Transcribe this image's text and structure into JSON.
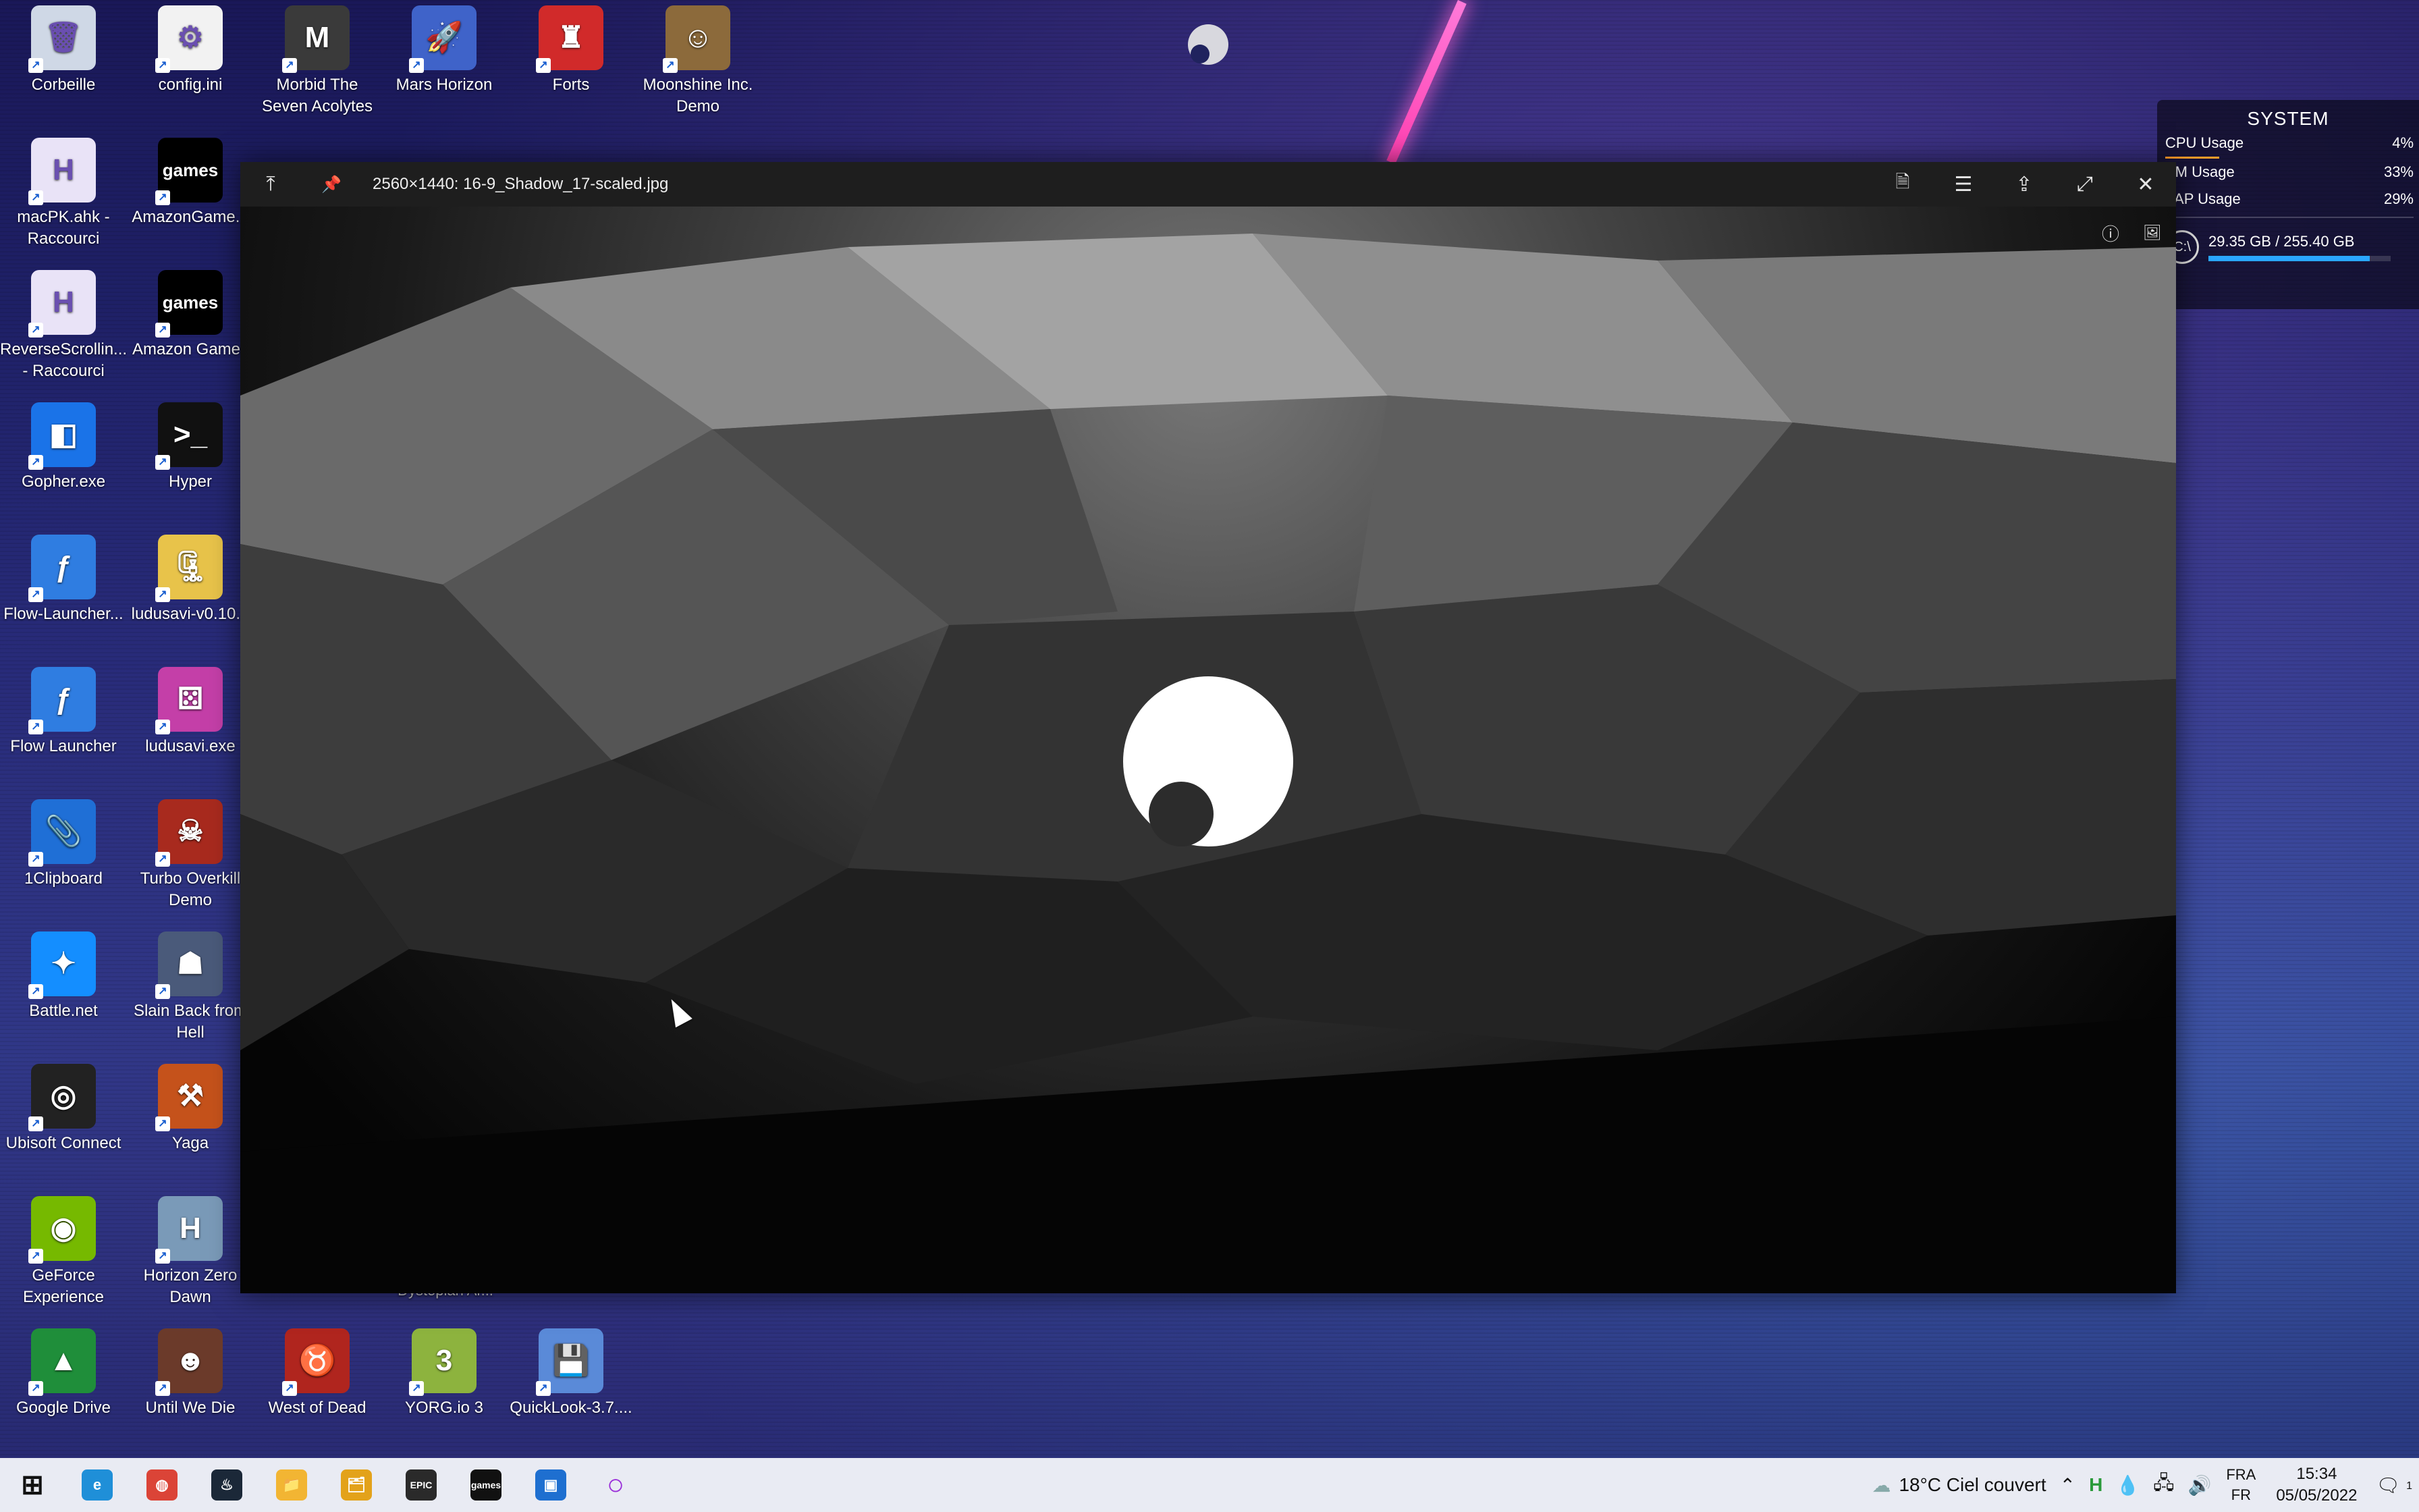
{
  "desktop": {
    "icons": [
      {
        "label": "Corbeille",
        "glyph": "🗑",
        "color": "#cfd8e6"
      },
      {
        "label": "config.ini",
        "glyph": "⚙",
        "color": "#f2f2f2"
      },
      {
        "label": "Morbid The Seven Acolytes",
        "glyph": "M",
        "color": "#3a3a3a"
      },
      {
        "label": "Mars Horizon",
        "glyph": "🚀",
        "color": "#3f63c9"
      },
      {
        "label": "Forts",
        "glyph": "♜",
        "color": "#d12a2a"
      },
      {
        "label": "Moonshine Inc. Demo",
        "glyph": "☺",
        "color": "#8c6a3b"
      },
      {
        "label": "macPK.ahk - Raccourci",
        "glyph": "H",
        "color": "#e9e3f7"
      },
      {
        "label": "AmazonGame...",
        "glyph": "games",
        "color": "#000000"
      },
      {
        "label": "ReverseScrollin... - Raccourci",
        "glyph": "H",
        "color": "#e9e3f7"
      },
      {
        "label": "Amazon Games",
        "glyph": "games",
        "color": "#000000"
      },
      {
        "label": "Gopher.exe",
        "glyph": "◧",
        "color": "#1a73e8"
      },
      {
        "label": "Hyper",
        "glyph": ">_",
        "color": "#111111"
      },
      {
        "label": "Flow-Launcher...",
        "glyph": "ƒ",
        "color": "#2f7de1"
      },
      {
        "label": "ludusavi-v0.10...",
        "glyph": "🗜",
        "color": "#e8c34a"
      },
      {
        "label": "Flow Launcher",
        "glyph": "ƒ",
        "color": "#2f7de1"
      },
      {
        "label": "ludusavi.exe",
        "glyph": "⚄",
        "color": "#c43fa8"
      },
      {
        "label": "1Clipboard",
        "glyph": "📎",
        "color": "#1f6fd6"
      },
      {
        "label": "Turbo Overkill Demo",
        "glyph": "☠",
        "color": "#a82a1e"
      },
      {
        "label": "Battle.net",
        "glyph": "✦",
        "color": "#148eff"
      },
      {
        "label": "Slain Back from Hell",
        "glyph": "☗",
        "color": "#4a5a7a"
      },
      {
        "label": "Ubisoft Connect",
        "glyph": "◎",
        "color": "#222222"
      },
      {
        "label": "Yaga",
        "glyph": "⚒",
        "color": "#c5521b"
      },
      {
        "label": "GeForce Experience",
        "glyph": "◉",
        "color": "#76b900"
      },
      {
        "label": "Horizon Zero Dawn",
        "glyph": "H",
        "color": "#7a9ab8"
      },
      {
        "label": "Google Drive",
        "glyph": "▲",
        "color": "#1f8e3a"
      },
      {
        "label": "Until We Die",
        "glyph": "☻",
        "color": "#6b3a2a"
      },
      {
        "label": "West of Dead",
        "glyph": "♉",
        "color": "#b0251e"
      },
      {
        "label": "YORG.io 3",
        "glyph": "3",
        "color": "#8db33e"
      },
      {
        "label": "QuickLook-3.7....",
        "glyph": "💾",
        "color": "#5a8ad8"
      }
    ],
    "partial_label": "Dystopian Ar..."
  },
  "sysmon": {
    "title": "SYSTEM",
    "cpu_label": "CPU Usage",
    "cpu_value": "4%",
    "cpu_fraction": 0.04,
    "ram_label": "AM Usage",
    "ram_value": "33%",
    "ram_fraction": 0.33,
    "swap_label": "VAP Usage",
    "swap_value": "29%",
    "swap_fraction": 0.29,
    "drive_letter": "C:\\",
    "disk_text": "29.35 GB / 255.40 GB",
    "disk_fraction": 0.885
  },
  "viewer": {
    "filename": "2560×1440: 16-9_Shadow_17-scaled.jpg",
    "buttons": {
      "top_icon": "⤒",
      "pin_icon": "📌",
      "open_with_icon": "🗎",
      "list_icon": "☰",
      "share_icon": "⇪",
      "fullscreen_icon": "⤢",
      "close_icon": "✕",
      "info_icon": "ⓘ",
      "wallpaper_icon": "🖼"
    }
  },
  "taskbar": {
    "apps": [
      {
        "name": "start",
        "glyph": "⊞"
      },
      {
        "name": "edge",
        "glyph": "e"
      },
      {
        "name": "chrome",
        "glyph": "◍"
      },
      {
        "name": "steam",
        "glyph": "♨"
      },
      {
        "name": "explorer-a",
        "glyph": "📁"
      },
      {
        "name": "explorer-b",
        "glyph": "🗂"
      },
      {
        "name": "epic",
        "glyph": "EPIC"
      },
      {
        "name": "amazon-games",
        "glyph": "games"
      },
      {
        "name": "app-blue",
        "glyph": "▣"
      },
      {
        "name": "circle-app",
        "glyph": "○"
      }
    ],
    "weather": "18°C  Ciel couvert",
    "lang_top": "FRA",
    "lang_bottom": "FR",
    "time": "15:34",
    "date": "05/05/2022",
    "notification_count": "1"
  }
}
